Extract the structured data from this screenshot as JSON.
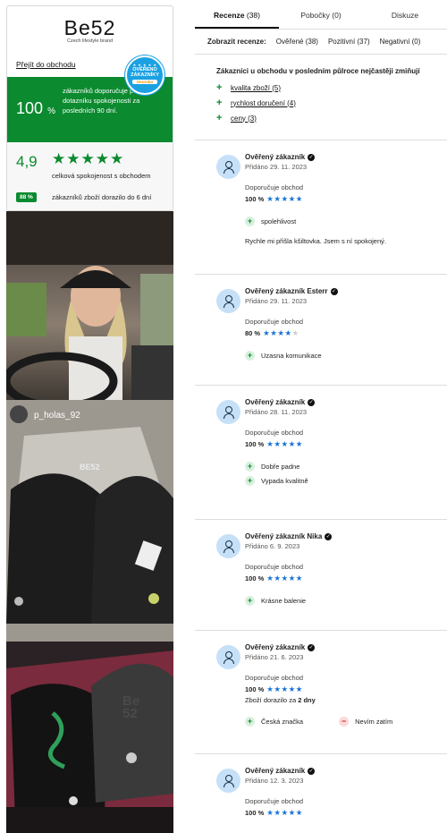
{
  "shop": {
    "logo_main": "Be52",
    "logo_sub": "Czech lifestyle brand",
    "link": "Přejít do obchodu",
    "badge": {
      "stars": "★ ★ ★ ★ ★",
      "line1": "OVĚŘENO",
      "line2": "ZÁKAZNÍKY",
      "provider": "Heureka"
    },
    "recommend_value": "100",
    "recommend_unit": "%",
    "recommend_text": "zákazníků doporučuje podle dotazníku spokojenosti za posledních 90 dní.",
    "rating_value": "4,9",
    "rating_stars": "★★★★★",
    "rating_label": "celková spokojenost s obchodem",
    "delivery_badge": "88 %",
    "delivery_text": "zákazníků zboží dorazilo do 6 dní"
  },
  "photos": {
    "user_handle": "p_holas_92",
    "cap_text_1": "BE52",
    "cap_text_2": "Be 52"
  },
  "tabs": [
    {
      "label": "Recenze",
      "count": "(38)",
      "active": true
    },
    {
      "label": "Pobočky",
      "count": "(0)",
      "active": false
    },
    {
      "label": "Diskuze",
      "count": "",
      "active": false
    }
  ],
  "filter": {
    "label": "Zobrazit recenze:",
    "options": [
      "Ověřené (38)",
      "Pozitivní (37)",
      "Negativní (0)"
    ]
  },
  "mentions": {
    "title": "Zákazníci u obchodu v posledním půlroce nejčastěji zmiňují",
    "items": [
      "kvalita zboží (5)",
      "rychlost doručení (4)",
      "ceny (3)"
    ]
  },
  "reviews": [
    {
      "name": "Ověřený zákazník",
      "date": "Přidáno 29. 11. 2023",
      "rec": "Doporučuje obchod",
      "score": "100 %",
      "stars_on": "★★★★★",
      "stars_off": "",
      "pros": [
        "spolehlivost"
      ],
      "cons": [],
      "text": "Rychle mi přišla kšiltovka. Jsem s ní spokojený.",
      "extra_prefix": "",
      "extra_bold": ""
    },
    {
      "name": "Ověřený zákazník Esterr",
      "date": "Přidáno 29. 11. 2023",
      "rec": "Doporučuje obchod",
      "score": "80 %",
      "stars_on": "★★★★",
      "stars_off": "★",
      "pros": [
        "Uzasna komunikace"
      ],
      "cons": [],
      "text": "",
      "extra_prefix": "",
      "extra_bold": ""
    },
    {
      "name": "Ověřený zákazník",
      "date": "Přidáno 28. 11. 2023",
      "rec": "Doporučuje obchod",
      "score": "100 %",
      "stars_on": "★★★★★",
      "stars_off": "",
      "pros": [
        "Dobře padne",
        "Vypada kvalitně"
      ],
      "cons": [],
      "text": "",
      "extra_prefix": "",
      "extra_bold": ""
    },
    {
      "name": "Ověřený zákazník Nika",
      "date": "Přidáno 6. 9. 2023",
      "rec": "Doporučuje obchod",
      "score": "100 %",
      "stars_on": "★★★★★",
      "stars_off": "",
      "pros": [
        "Krásne balenie"
      ],
      "cons": [],
      "text": "",
      "extra_prefix": "",
      "extra_bold": ""
    },
    {
      "name": "Ověřený zákazník",
      "date": "Přidáno 21. 6. 2023",
      "rec": "Doporučuje obchod",
      "score": "100 %",
      "stars_on": "★★★★★",
      "stars_off": "",
      "pros": [
        "Česká značka"
      ],
      "cons": [
        "Nevím zatím"
      ],
      "text": "",
      "extra_prefix": "Zboží dorazilo za ",
      "extra_bold": "2 dny"
    },
    {
      "name": "Ověřený zákazník",
      "date": "Přidáno 12. 3. 2023",
      "rec": "Doporučuje obchod",
      "score": "100 %",
      "stars_on": "★★★★★",
      "stars_off": "",
      "pros": [],
      "cons": [],
      "text": "",
      "extra_prefix": "",
      "extra_bold": ""
    }
  ]
}
